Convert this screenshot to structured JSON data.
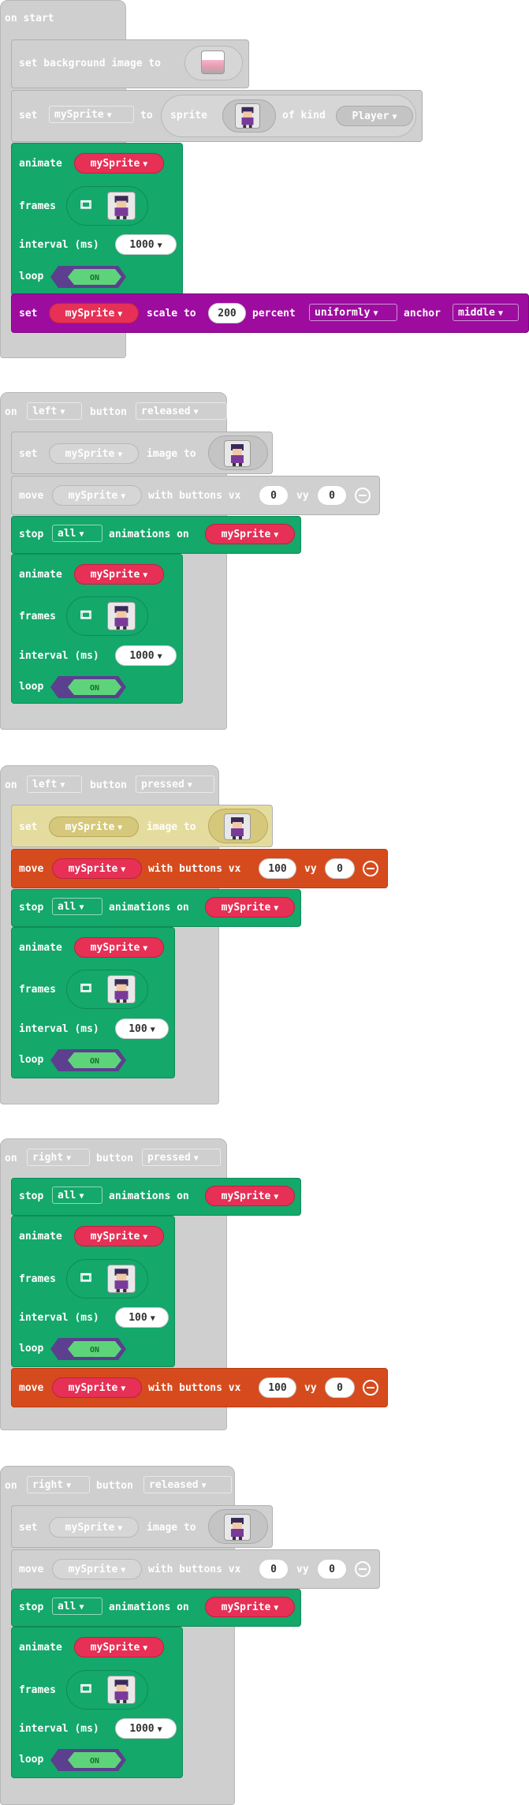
{
  "blocks": {
    "on_start": "on start",
    "set_bg": "set background image to",
    "set": "set",
    "to": "to",
    "sprite": "sprite",
    "of_kind": "of kind",
    "kind_player": "Player",
    "animate": "animate",
    "frames": "frames",
    "interval": "interval (ms)",
    "loop": "loop",
    "on_toggle": "ON",
    "scale_to": "scale to",
    "percent": "percent",
    "uniformly": "uniformly",
    "anchor": "anchor",
    "middle": "middle",
    "on": "on",
    "button": "button",
    "left": "left",
    "right": "right",
    "released": "released",
    "pressed": "pressed",
    "image_to": "image to",
    "move": "move",
    "with_buttons_vx": "with buttons vx",
    "vy": "vy",
    "stop": "stop",
    "all": "all",
    "animations_on": "animations on",
    "mySprite": "mySprite"
  },
  "values": {
    "scale_value": "200",
    "interval_1000": "1000",
    "interval_100": "100",
    "vx_0": "0",
    "vy_0": "0",
    "vx_100": "100"
  },
  "icons": {
    "caret": "▼",
    "film": "🎞"
  },
  "colors": {
    "event_grey": "#cfcfcf",
    "animation_green": "#14a86b",
    "sprite_red": "#e63056",
    "scene_purple": "#9d0c9f",
    "controller_orange": "#d64b1d",
    "toggle_purple": "#5c3f8f",
    "toggle_green": "#5ed47a"
  }
}
